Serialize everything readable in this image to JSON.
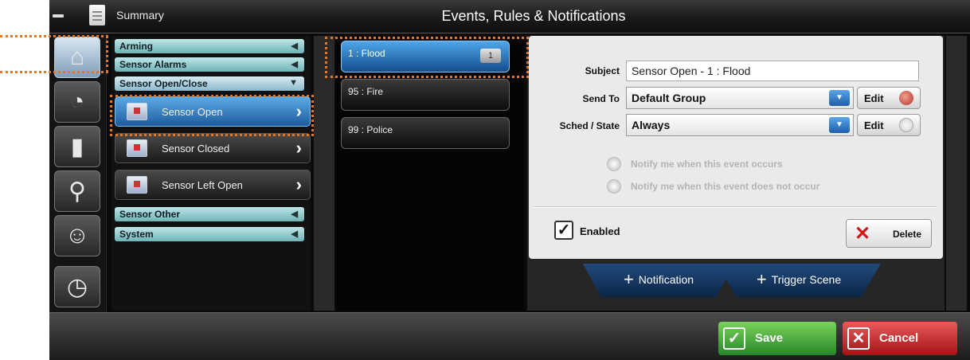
{
  "titlebar": {
    "summary": "Summary",
    "title": "Events, Rules & Notifications"
  },
  "nav_icons": [
    "home-security-icon",
    "camera-icon",
    "light-switch-icon",
    "map-pin-icon",
    "user-tools-icon",
    "stopwatch-icon"
  ],
  "categories": [
    {
      "label": "Arming",
      "arrow": "◀"
    },
    {
      "label": "Sensor Alarms",
      "arrow": "◀"
    },
    {
      "label": "Sensor Open/Close",
      "arrow": "▼"
    },
    {
      "label": "Sensor Other",
      "arrow": "◀"
    },
    {
      "label": "System",
      "arrow": "◀"
    }
  ],
  "subitems": [
    {
      "label": "Sensor Open"
    },
    {
      "label": "Sensor Closed"
    },
    {
      "label": "Sensor Left Open"
    }
  ],
  "events": [
    {
      "label": "1 : Flood",
      "badge": "1"
    },
    {
      "label": "95 : Fire"
    },
    {
      "label": "99 : Police"
    }
  ],
  "details": {
    "subject_label": "Subject",
    "subject_value": "Sensor Open - 1 : Flood",
    "sendto_label": "Send To",
    "sendto_value": "Default Group",
    "sched_label": "Sched / State",
    "sched_value": "Always",
    "edit_label": "Edit",
    "radio_occurs": "Notify me when this event occurs",
    "radio_not_occurs": "Notify me when this event does not occur",
    "enabled_label": "Enabled",
    "delete_label": "Delete"
  },
  "tabs": {
    "notification": "Notification",
    "trigger_scene": "Trigger Scene"
  },
  "bottom": {
    "save": "Save",
    "cancel": "Cancel"
  },
  "colors": {
    "highlight": "#e8761e",
    "save": "#3aa33a",
    "cancel": "#c42222",
    "selected": "#2f7fcf"
  }
}
